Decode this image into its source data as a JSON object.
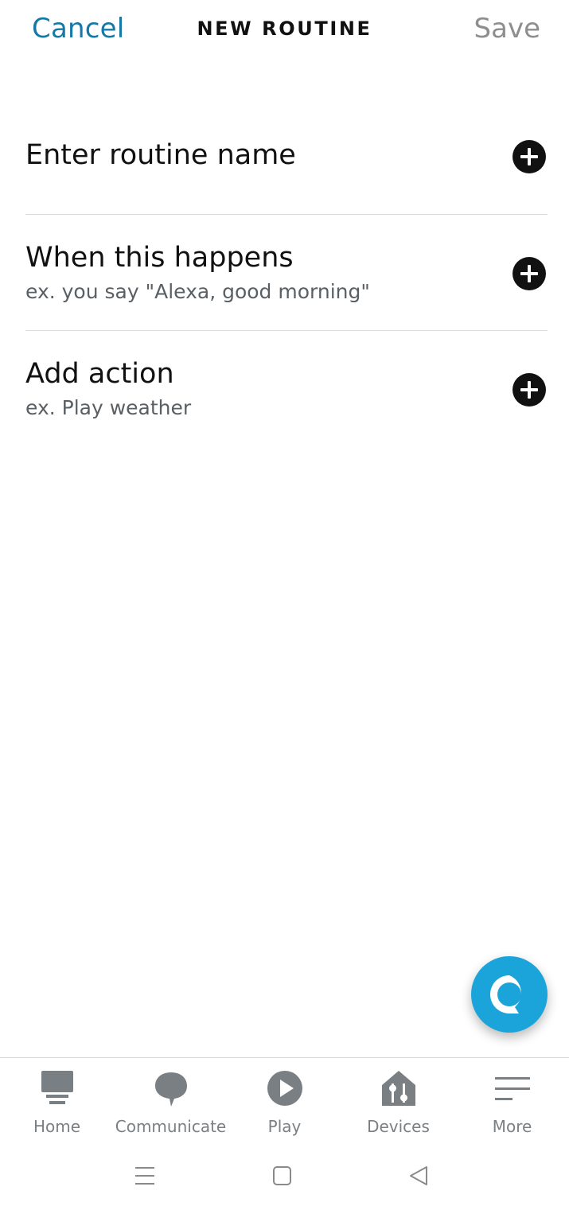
{
  "header": {
    "cancel_label": "Cancel",
    "title": "NEW ROUTINE",
    "save_label": "Save"
  },
  "rows": [
    {
      "title": "Enter routine name",
      "hint": ""
    },
    {
      "title": "When this happens",
      "hint": "ex. you say \"Alexa, good morning\""
    },
    {
      "title": "Add action",
      "hint": "ex. Play weather"
    }
  ],
  "alexa_button": {
    "icon": "alexa-ring-icon"
  },
  "bottom_nav": [
    {
      "label": "Home",
      "icon": "home-icon"
    },
    {
      "label": "Communicate",
      "icon": "speech-bubble-icon"
    },
    {
      "label": "Play",
      "icon": "play-icon"
    },
    {
      "label": "Devices",
      "icon": "devices-house-icon"
    },
    {
      "label": "More",
      "icon": "menu-lines-icon"
    }
  ],
  "system_nav": [
    "recents-icon",
    "home-square-icon",
    "back-triangle-icon"
  ],
  "colors": {
    "accent": "#1579a8",
    "alexa_blue": "#1ba4d9",
    "save_disabled": "#8e8e8e",
    "nav_gray": "#7a7f83"
  }
}
